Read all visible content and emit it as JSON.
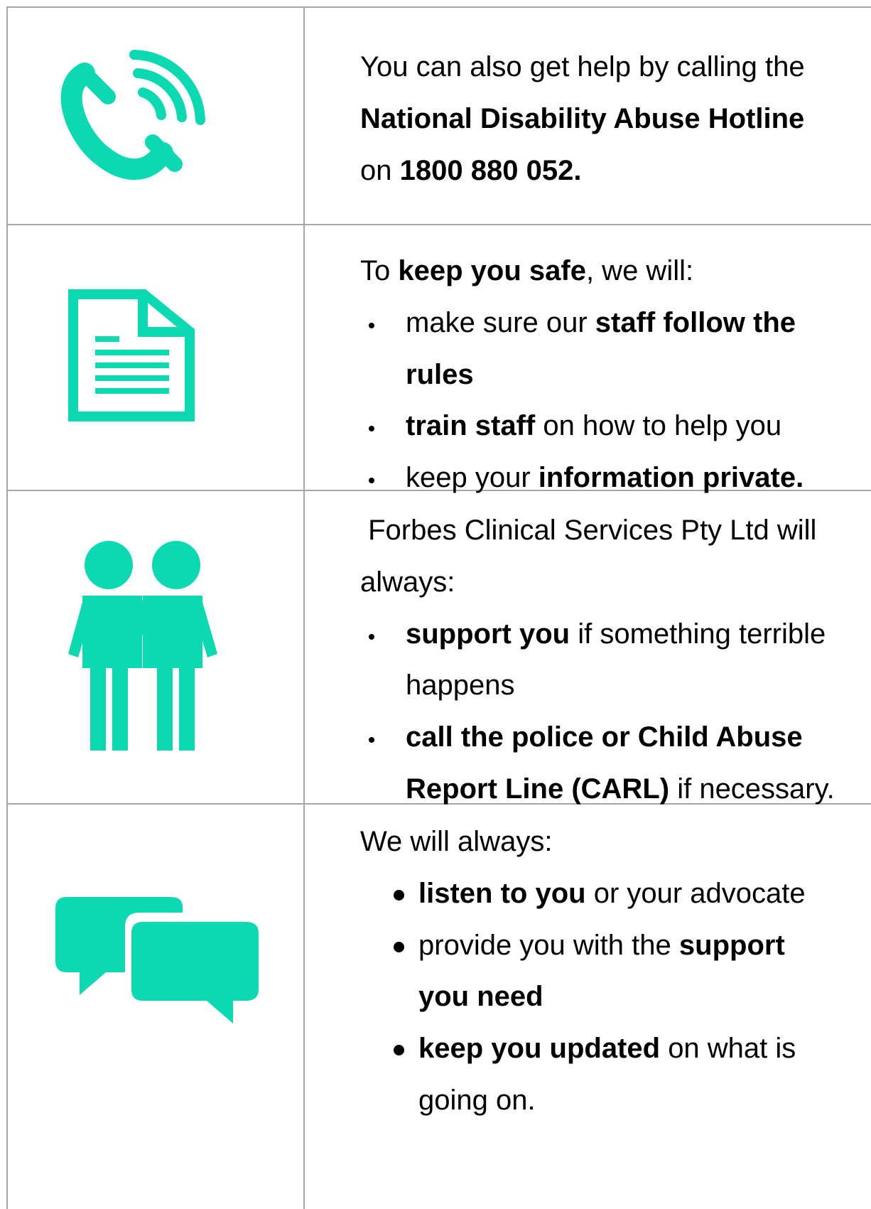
{
  "accent_color": "#0bd9b2",
  "row1": {
    "icon": "phone-icon",
    "line1": "You can also get help by calling the",
    "hotline_name": "National Disability Abuse Hotline",
    "on_word": "on",
    "phone_number": "1800 880 052."
  },
  "row2": {
    "icon": "document-icon",
    "intro_prefix": "To",
    "intro_bold": "keep you safe",
    "intro_suffix": ", we will:",
    "b1_pre": "make sure our",
    "b1_bold_a": "staff follow the",
    "b1_bold_b": "rules",
    "b2_bold": "train staff",
    "b2_post": "on how to help you",
    "b3_pre": "keep your",
    "b3_bold": "information private."
  },
  "row3": {
    "icon": "two-people-icon",
    "intro_line1": "Forbes Clinical Services Pty Ltd will",
    "intro_line2": "always:",
    "b1_bold": "support you",
    "b1_post": "if something terrible",
    "b1_line2": "happens",
    "b2_bold_a": "call the police or Child Abuse",
    "b2_bold_b": "Report Line (CARL)",
    "b2_post": "if necessary."
  },
  "row4": {
    "icon": "speech-bubbles-icon",
    "intro": "We will always:",
    "b1_bold": "listen to you",
    "b1_post": "or your advocate",
    "b2_pre": "provide you with the",
    "b2_bold_a": "support",
    "b2_bold_b": "you need",
    "b3_bold": "keep you updated",
    "b3_post": "on what is",
    "b3_line2": "going on."
  }
}
